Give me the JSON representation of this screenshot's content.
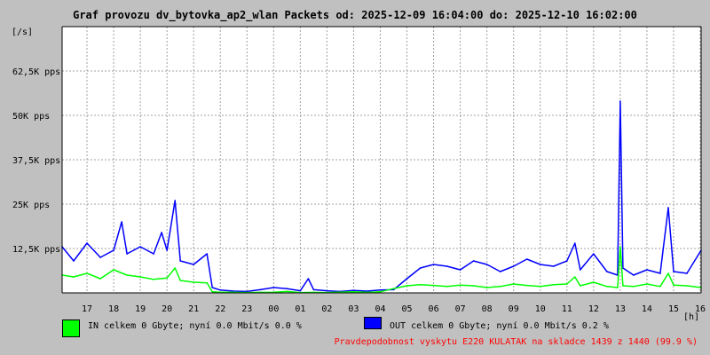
{
  "title": "Graf provozu dv_bytovka_ap2_wlan Packets od: 2025-12-09 16:04:00 do: 2025-12-10 16:02:00",
  "colors": {
    "background": "#c0c0c0",
    "plot_background": "#ffffff",
    "grid": "#a0a0a0",
    "in_series": "#00ff00",
    "out_series": "#0000ff",
    "out_peak": "#00a0a0",
    "footer_text": "#ff0000"
  },
  "chart_data": {
    "type": "area",
    "title": "Graf provozu dv_bytovka_ap2_wlan Packets od: 2025-12-09 16:04:00 do: 2025-12-10 16:02:00",
    "ylabel": "[/s]",
    "xlabel": "[h]",
    "ylim": [
      0,
      75000
    ],
    "y_ticks": [
      12500,
      25000,
      37500,
      50000,
      62500
    ],
    "y_tick_labels": [
      "12,5K pps",
      "25K pps",
      "37,5K pps",
      "50K pps",
      "62,5K pps"
    ],
    "x_tick_labels": [
      "17",
      "18",
      "19",
      "20",
      "21",
      "22",
      "23",
      "00",
      "01",
      "02",
      "03",
      "04",
      "05",
      "06",
      "07",
      "08",
      "09",
      "10",
      "11",
      "12",
      "13",
      "14",
      "15",
      "16"
    ],
    "x_start_hour": 16.067,
    "x_end_hour": 40.033,
    "grid": true,
    "series": [
      {
        "name": "IN",
        "hours": [
          16.067,
          16.5,
          17.0,
          17.5,
          18.0,
          18.5,
          19.0,
          19.5,
          20.0,
          20.3,
          20.5,
          21.0,
          21.5,
          21.7,
          22.0,
          22.5,
          23.0,
          23.5,
          24.0,
          24.5,
          25.0,
          25.5,
          26.0,
          26.5,
          27.0,
          27.5,
          28.0,
          28.5,
          29.0,
          29.5,
          30.0,
          30.5,
          31.0,
          31.5,
          32.0,
          32.5,
          33.0,
          33.5,
          34.0,
          34.5,
          35.0,
          35.3,
          35.5,
          36.0,
          36.5,
          36.9,
          37.0,
          37.1,
          37.5,
          38.0,
          38.5,
          38.8,
          39.0,
          39.5,
          40.033
        ],
        "values": [
          5000,
          4500,
          5500,
          4000,
          6500,
          5000,
          4500,
          3800,
          4200,
          7000,
          3500,
          3000,
          2800,
          300,
          200,
          150,
          100,
          150,
          200,
          400,
          100,
          150,
          100,
          200,
          300,
          150,
          300,
          1200,
          2000,
          2300,
          2100,
          1800,
          2200,
          2000,
          1500,
          1800,
          2500,
          2100,
          1800,
          2300,
          2500,
          4500,
          2000,
          3000,
          1800,
          1500,
          13000,
          2000,
          1800,
          2500,
          1800,
          5500,
          2200,
          2000,
          1500
        ]
      },
      {
        "name": "OUT",
        "hours": [
          16.067,
          16.5,
          17.0,
          17.5,
          18.0,
          18.3,
          18.5,
          19.0,
          19.5,
          19.8,
          20.0,
          20.3,
          20.5,
          21.0,
          21.5,
          21.7,
          22.0,
          22.5,
          23.0,
          23.5,
          24.0,
          24.5,
          25.0,
          25.3,
          25.5,
          26.0,
          26.5,
          27.0,
          27.5,
          28.0,
          28.5,
          29.0,
          29.5,
          30.0,
          30.5,
          31.0,
          31.5,
          32.0,
          32.5,
          33.0,
          33.5,
          34.0,
          34.5,
          35.0,
          35.3,
          35.5,
          36.0,
          36.5,
          36.9,
          37.0,
          37.1,
          37.5,
          38.0,
          38.5,
          38.8,
          39.0,
          39.5,
          40.033
        ],
        "values": [
          13000,
          9000,
          14000,
          10000,
          12000,
          20000,
          11000,
          13000,
          11000,
          17000,
          12000,
          26000,
          9000,
          8000,
          11000,
          1500,
          800,
          500,
          400,
          900,
          1500,
          1200,
          600,
          4000,
          900,
          600,
          400,
          700,
          500,
          800,
          900,
          4000,
          7000,
          8000,
          7500,
          6500,
          9000,
          8000,
          6000,
          7500,
          9500,
          8000,
          7500,
          9000,
          14000,
          6500,
          11000,
          6000,
          5000,
          54000,
          7000,
          5000,
          6500,
          5500,
          24000,
          6000,
          5500,
          12000
        ]
      }
    ],
    "legend": [
      {
        "series": "IN",
        "text": "IN celkem 0 Gbyte; nyní   0.0 Mbit/s 0.0 %"
      },
      {
        "series": "OUT",
        "text": "OUT celkem 0 Gbyte; nyní   0.0 Mbit/s 0.2 %"
      }
    ],
    "legend_placement": "bottom-left"
  },
  "footer": "Pravdepodobnost vyskytu E220 KULATAK na skladce 1439 z 1440 (99.9 %)"
}
